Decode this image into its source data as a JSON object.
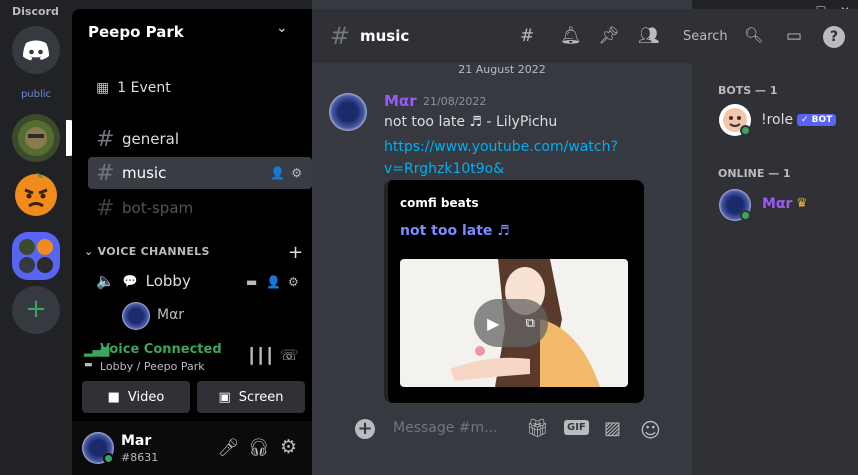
{
  "titlebar": {
    "brand": "Discord",
    "minimize": "—",
    "maximize": "☐",
    "close": "✕"
  },
  "servers": {
    "public_label": "public"
  },
  "sidebar": {
    "server_name": "Peepo Park",
    "events": "1 Event",
    "channels": [
      {
        "name": "general"
      },
      {
        "name": "music"
      },
      {
        "name": "bot-spam"
      }
    ],
    "voice_category": "VOICE CHANNELS",
    "voice_channel": "Lobby",
    "voice_user": "Mαr"
  },
  "voice_panel": {
    "status": "Voice Connected",
    "location": "Lobby / Peepo Park",
    "video_label": "Video",
    "screen_label": "Screen"
  },
  "user_panel": {
    "username": "Mar",
    "discriminator": "#8631"
  },
  "chat": {
    "channel_name": "music",
    "search_placeholder": "Search",
    "date_divider": "21 August 2022",
    "message": {
      "author": "Mαr",
      "timestamp": "21/08/2022",
      "text": "not too late ♬ - LilyPichu",
      "link": "https://www.youtube.com/watch?v=Rrghzk10t9o&"
    },
    "embed": {
      "provider": "comfi beats",
      "title": "not too late ♬"
    },
    "composer_placeholder": "Message #m...",
    "gif_label": "GIF"
  },
  "members": {
    "bots_header": "BOTS — 1",
    "bot_name": "!role",
    "bot_tag": "✓ BOT",
    "online_header": "ONLINE — 1",
    "online_user": "Mαr",
    "crown": "♛"
  },
  "colors": {
    "accent": "#5865f2",
    "online": "#3ba55d",
    "author": "#9b59f5",
    "link": "#00aff4"
  }
}
